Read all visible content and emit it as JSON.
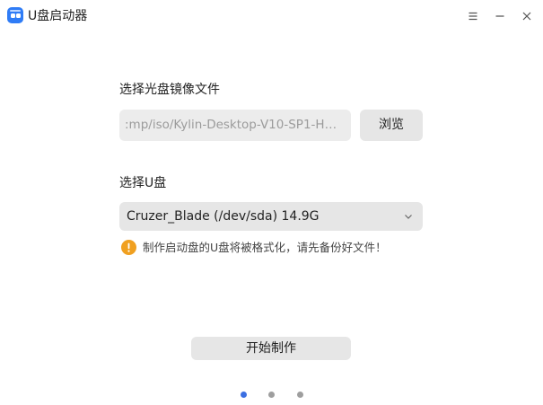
{
  "window": {
    "title": "U盘启动器",
    "icon": "usb-boot-app-icon",
    "controls": [
      "menu-icon",
      "minimize-icon",
      "close-icon"
    ]
  },
  "iso": {
    "label": "选择光盘镜像文件",
    "path_value": ":mp/iso/Kylin-Desktop-V10-SP1-HW...",
    "browse_label": "浏览"
  },
  "usb": {
    "label": "选择U盘",
    "selected": "Cruzer_Blade (/dev/sda) 14.9G",
    "dropdown_icon": "chevron-down-icon"
  },
  "warning": {
    "icon": "warning-icon",
    "text": "制作启动盘的U盘将被格式化，请先备份好文件！",
    "color": "#f0a020"
  },
  "actions": {
    "start_label": "开始制作"
  },
  "pager": {
    "total": 3,
    "current": 1,
    "active_color": "#3b6fe2"
  }
}
